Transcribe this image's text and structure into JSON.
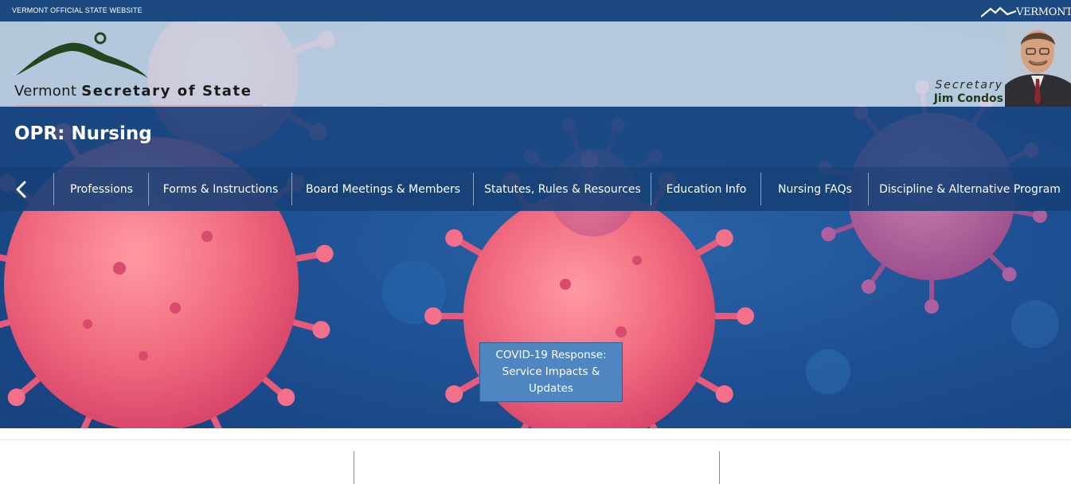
{
  "state_bar": {
    "official_label": "VERMONT OFFICIAL STATE WEBSITE",
    "state_logo_text": "VERMONT"
  },
  "header": {
    "site_title_prefix": "Vermont",
    "site_title_bold": "Secretary of State",
    "secretary_label": "Secretary",
    "secretary_name": "Jim Condos"
  },
  "page": {
    "title": "OPR: Nursing"
  },
  "nav": {
    "back_icon": "chevron-left-icon",
    "items": [
      {
        "label": "Professions"
      },
      {
        "label": "Forms & Instructions"
      },
      {
        "label": "Board Meetings & Members"
      },
      {
        "label": "Statutes, Rules & Resources"
      },
      {
        "label": "Education Info"
      },
      {
        "label": "Nursing FAQs"
      },
      {
        "label": "Discipline & Alternative Program"
      }
    ]
  },
  "hero": {
    "button_label": "COVID-19 Response: Service Impacts & Updates"
  },
  "colors": {
    "state_bar": "#1c4a80",
    "nav_bg": "#164077",
    "button_bg": "#4f86c1",
    "virus": "#f06a7e"
  }
}
